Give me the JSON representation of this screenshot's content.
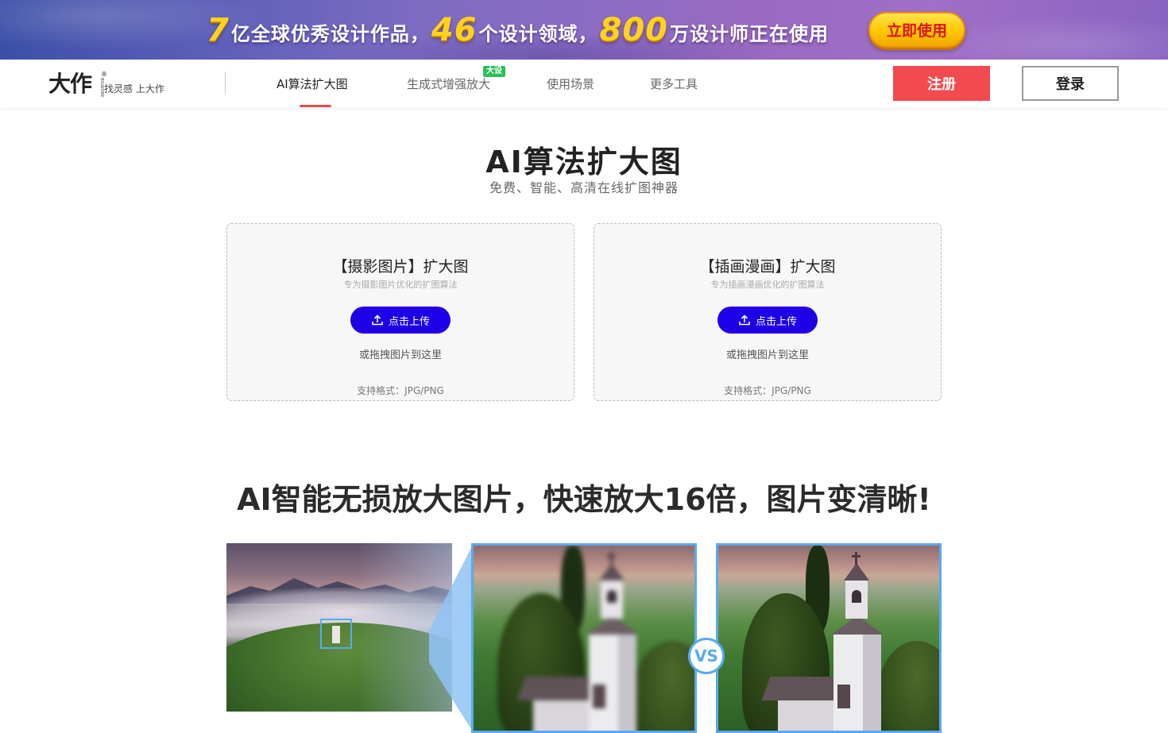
{
  "banner": {
    "text_1": "7",
    "text_2": "亿全球优秀设计作品，",
    "text_3": "46",
    "text_4": "个设计领域，",
    "text_5": "800",
    "text_6": "万设计师正在使用",
    "cta_label": "立即使用"
  },
  "nav": {
    "logo_main": "大作",
    "logo_mark": "®",
    "logo_side": "BIGWORK",
    "logo_slogan": "找灵感 上大作",
    "items": [
      {
        "label": "AI算法扩大图",
        "active": true
      },
      {
        "label": "生成式增强放大",
        "badge": "大设"
      },
      {
        "label": "使用场景"
      },
      {
        "label": "更多工具"
      }
    ],
    "register_label": "注册",
    "login_label": "登录"
  },
  "hero": {
    "title": "AI算法扩大图",
    "subtitle": "免费、智能、高清在线扩图神器"
  },
  "cards": [
    {
      "title": "【摄影图片】扩大图",
      "desc": "专为摄影图片优化的扩图算法",
      "button_label": "点击上传",
      "drag_text": "或拖拽图片到这里",
      "format_text": "支持格式：JPG/PNG"
    },
    {
      "title": "【插画漫画】扩大图",
      "desc": "专为插画漫画优化的扩图算法",
      "button_label": "点击上传",
      "drag_text": "或拖拽图片到这里",
      "format_text": "支持格式：JPG/PNG"
    }
  ],
  "feature": {
    "title": "AI智能无损放大图片，快速放大16倍，图片变清晰!",
    "vs_label": "VS"
  },
  "colors": {
    "accent_red": "#f24a4e",
    "upload_blue": "#1f00e6",
    "highlight_blue": "#5aa9f0",
    "banner_yellow": "#ffd21f"
  },
  "icons": {
    "upload": "upload-icon"
  }
}
